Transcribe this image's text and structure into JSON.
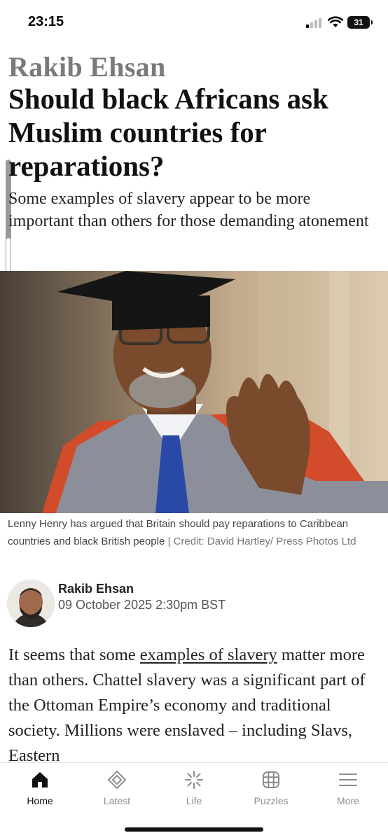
{
  "status_bar": {
    "time": "23:15",
    "battery": "31"
  },
  "article": {
    "author_kicker": "Rakib Ehsan",
    "headline": "Should black Africans ask Muslim countries for reparations?",
    "standfirst": "Some examples of slavery appear to be more important than others for those demanding atonement",
    "image_caption": "Lenny Henry has argued that Britain should pay reparations to Caribbean countries and black British people",
    "image_credit": "Credit: David Hartley/ Press Photos Ltd",
    "byline": {
      "name": "Rakib Ehsan",
      "date": "09 October 2025 2:30pm BST"
    },
    "body": {
      "intro": "It seems that some ",
      "link": "examples of slavery",
      "rest": " matter more than others. Chattel slavery was a significant part of the Ottoman Empire’s economy and traditional society. Millions were enslaved – including Slavs, Eastern"
    }
  },
  "tab_bar": {
    "items": [
      {
        "label": "Home",
        "icon": "home-icon",
        "active": true
      },
      {
        "label": "Latest",
        "icon": "latest-icon",
        "active": false
      },
      {
        "label": "Life",
        "icon": "life-icon",
        "active": false
      },
      {
        "label": "Puzzles",
        "icon": "puzzles-icon",
        "active": false
      },
      {
        "label": "More",
        "icon": "menu-icon",
        "active": false
      }
    ]
  },
  "colors": {
    "active_tab": "#111111",
    "inactive_tab": "#8c8c8c",
    "kicker": "#7a7a7a"
  }
}
